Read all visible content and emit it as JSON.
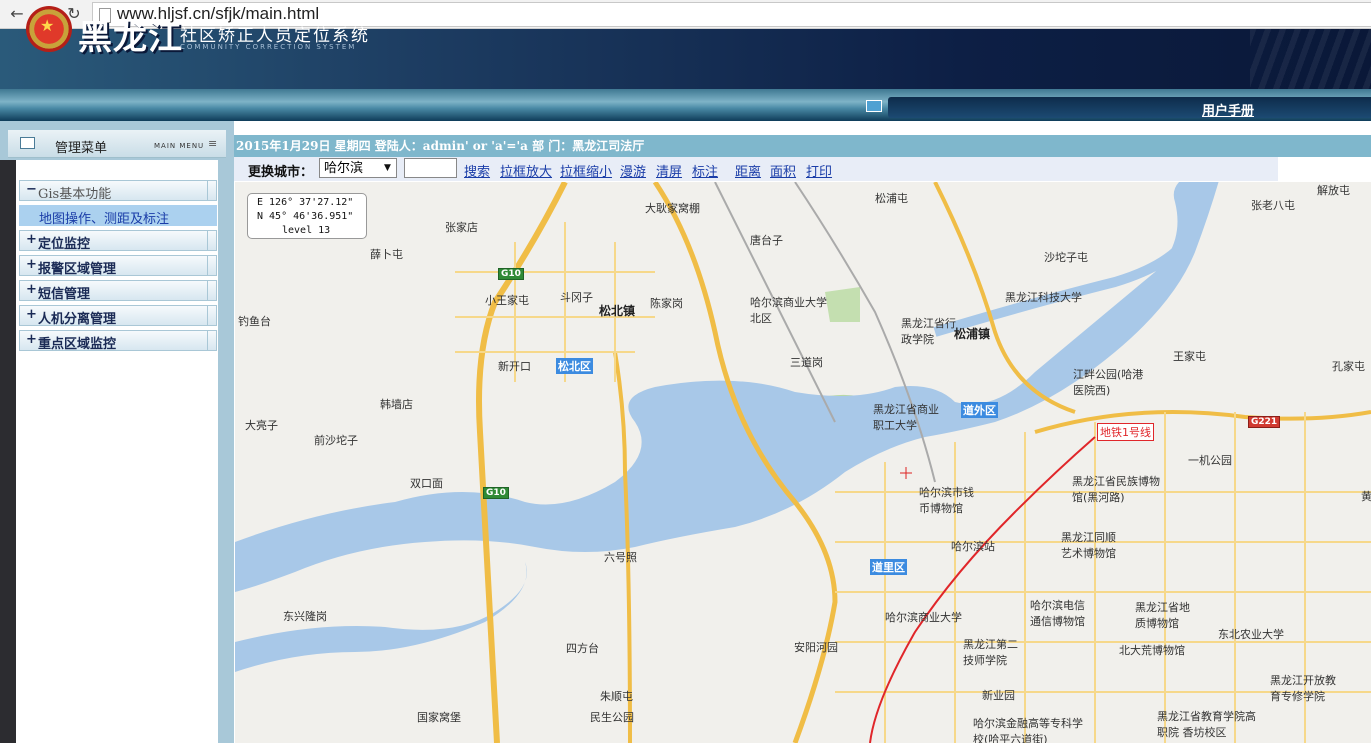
{
  "browser": {
    "url": "www.hljsf.cn/sfjk/main.html",
    "back_icon": "back-arrow-icon",
    "forward_icon": "forward-arrow-icon",
    "reload_icon": "reload-icon"
  },
  "header": {
    "brand": "黑龙江",
    "system_title": "社区矫正人员定位系统",
    "system_title_en": "COMMUNITY CORRECTION SYSTEM",
    "manual_link": "用户手册"
  },
  "left_panel": {
    "title": "管理菜单",
    "title_en": "MAIN MENU",
    "menu": [
      {
        "prefix": "−",
        "label": "Gis基本功能"
      },
      {
        "prefix": "+",
        "label": "定位监控"
      },
      {
        "prefix": "+",
        "label": "报警区域管理"
      },
      {
        "prefix": "+",
        "label": "短信管理"
      },
      {
        "prefix": "+",
        "label": "人机分离管理"
      },
      {
        "prefix": "+",
        "label": "重点区域监控"
      }
    ],
    "submenu": "地图操作、测距及标注"
  },
  "info_bar": {
    "text": "2015年1月29日 星期四 登陆人：admin' or 'a'='a 部 门：黑龙江司法厅"
  },
  "toolbar": {
    "city_label": "更换城市：",
    "city_value": "哈尔滨",
    "search_value": "",
    "links": [
      "搜索",
      "拉框放大",
      "拉框缩小",
      "漫游",
      "清屏",
      "标注",
      "距离",
      "面积",
      "打印"
    ]
  },
  "map": {
    "coords": {
      "lon": "E 126° 37'27.12\"",
      "lat": "N 45° 46'36.951\"",
      "level": "level 13"
    },
    "labels": [
      "松浦屯",
      "大耿家窝棚",
      "唐台子",
      "张家店",
      "薛卜屯",
      "小王家屯",
      "斗冈子",
      "陈家岗",
      "松北镇",
      "哈尔滨商业大学北区",
      "黑龙江省行政学院",
      "松浦镇",
      "黑龙江科技大学",
      "沙坨子屯",
      "张老八屯",
      "王家屯",
      "孔家屯",
      "江畔公园(哈港医院西)",
      "钓鱼台",
      "新开口",
      "三道岗",
      "韩墙店",
      "黑龙江省商业职工大学",
      "一机公园",
      "大亮子",
      "前沙坨子",
      "双口面",
      "哈尔滨市钱币博物馆",
      "黑龙江省民族博物馆(黑河路)",
      "哈尔滨站",
      "黑龙江同顺艺术博物馆",
      "六号照",
      "东兴隆岗",
      "哈尔滨商业大学",
      "哈尔滨电信通信博物馆",
      "黑龙江省地质博物馆",
      "东北农业大学",
      "四方台",
      "安阳河园",
      "黑龙江第二技师学院",
      "北大荒博物馆",
      "朱顺屯",
      "新业园",
      "黑龙江开放教育专修学院",
      "国家窝堡",
      "民生公园",
      "哈尔滨金融高等专科学校(哈平六道街)",
      "黑龙江省教育学院高职院 香坊校区",
      "解放屯",
      "黄"
    ],
    "districts": [
      "松北区",
      "道外区",
      "道里区"
    ],
    "shields": [
      "G10",
      "G10",
      "G221"
    ],
    "metro": "地铁1号线"
  }
}
